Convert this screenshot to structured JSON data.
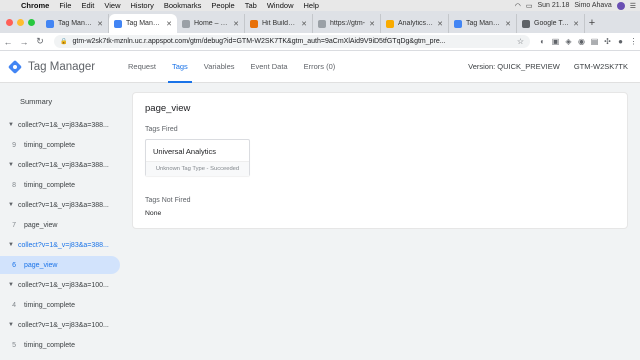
{
  "menubar": {
    "app": "Chrome",
    "items": [
      "File",
      "Edit",
      "View",
      "History",
      "Bookmarks",
      "People",
      "Tab",
      "Window",
      "Help"
    ],
    "clock": "Sun 21.18",
    "user": "Simo Ahava"
  },
  "tabs": [
    {
      "label": "Tag Manager",
      "color": "#4285f4",
      "active": false
    },
    {
      "label": "Tag Manager",
      "color": "#4285f4",
      "active": true
    },
    {
      "label": "Home – GTM",
      "color": "#9aa0a6",
      "active": false
    },
    {
      "label": "Hit Builder –",
      "color": "#e8710a",
      "active": false
    },
    {
      "label": "https://gtm-",
      "color": "#9aa0a6",
      "active": false
    },
    {
      "label": "Analytics 36",
      "color": "#f9ab00",
      "active": false
    },
    {
      "label": "Tag Manager",
      "color": "#4285f4",
      "active": false
    },
    {
      "label": "Google Tag M",
      "color": "#5f6368",
      "active": false
    }
  ],
  "toolbar": {
    "url": "gtm-w2sk7tk-mznln.uc.r.appspot.com/gtm/debug?id=GTM-W2SK7TK&gtm_auth=9aCmXlAid9V9iD5tfGTqDg&gtm_pre..."
  },
  "header": {
    "app_name": "Tag Manager",
    "nav": [
      "Request",
      "Tags",
      "Variables",
      "Event Data",
      "Errors (0)"
    ],
    "active_nav": "Tags",
    "version": "Version: QUICK_PREVIEW",
    "container": "GTM-W2SK7TK"
  },
  "sidebar": {
    "summary": "Summary",
    "items": [
      {
        "kind": "request",
        "label": "collect?v=1&_v=j83&a=388...",
        "highlighted": false
      },
      {
        "kind": "event",
        "num": "9",
        "label": "timing_complete",
        "selected": false
      },
      {
        "kind": "request",
        "label": "collect?v=1&_v=j83&a=388...",
        "highlighted": false
      },
      {
        "kind": "event",
        "num": "8",
        "label": "timing_complete",
        "selected": false
      },
      {
        "kind": "request",
        "label": "collect?v=1&_v=j83&a=388...",
        "highlighted": false
      },
      {
        "kind": "event",
        "num": "7",
        "label": "page_view",
        "selected": false
      },
      {
        "kind": "request",
        "label": "collect?v=1&_v=j83&a=388...",
        "highlighted": true
      },
      {
        "kind": "event",
        "num": "6",
        "label": "page_view",
        "selected": true
      },
      {
        "kind": "request",
        "label": "collect?v=1&_v=j83&a=100...",
        "highlighted": false
      },
      {
        "kind": "event",
        "num": "4",
        "label": "timing_complete",
        "selected": false
      },
      {
        "kind": "request",
        "label": "collect?v=1&_v=j83&a=100...",
        "highlighted": false
      },
      {
        "kind": "event",
        "num": "5",
        "label": "timing_complete",
        "selected": false
      }
    ]
  },
  "main": {
    "title": "page_view",
    "fired_heading": "Tags Fired",
    "fired_tags": [
      {
        "name": "Universal Analytics",
        "status": "Unknown Tag Type - Succeeded"
      }
    ],
    "not_fired_heading": "Tags Not Fired",
    "not_fired_value": "None"
  },
  "colors": {
    "accent": "#1a73e8",
    "selected_bg": "#d2e3fc"
  }
}
